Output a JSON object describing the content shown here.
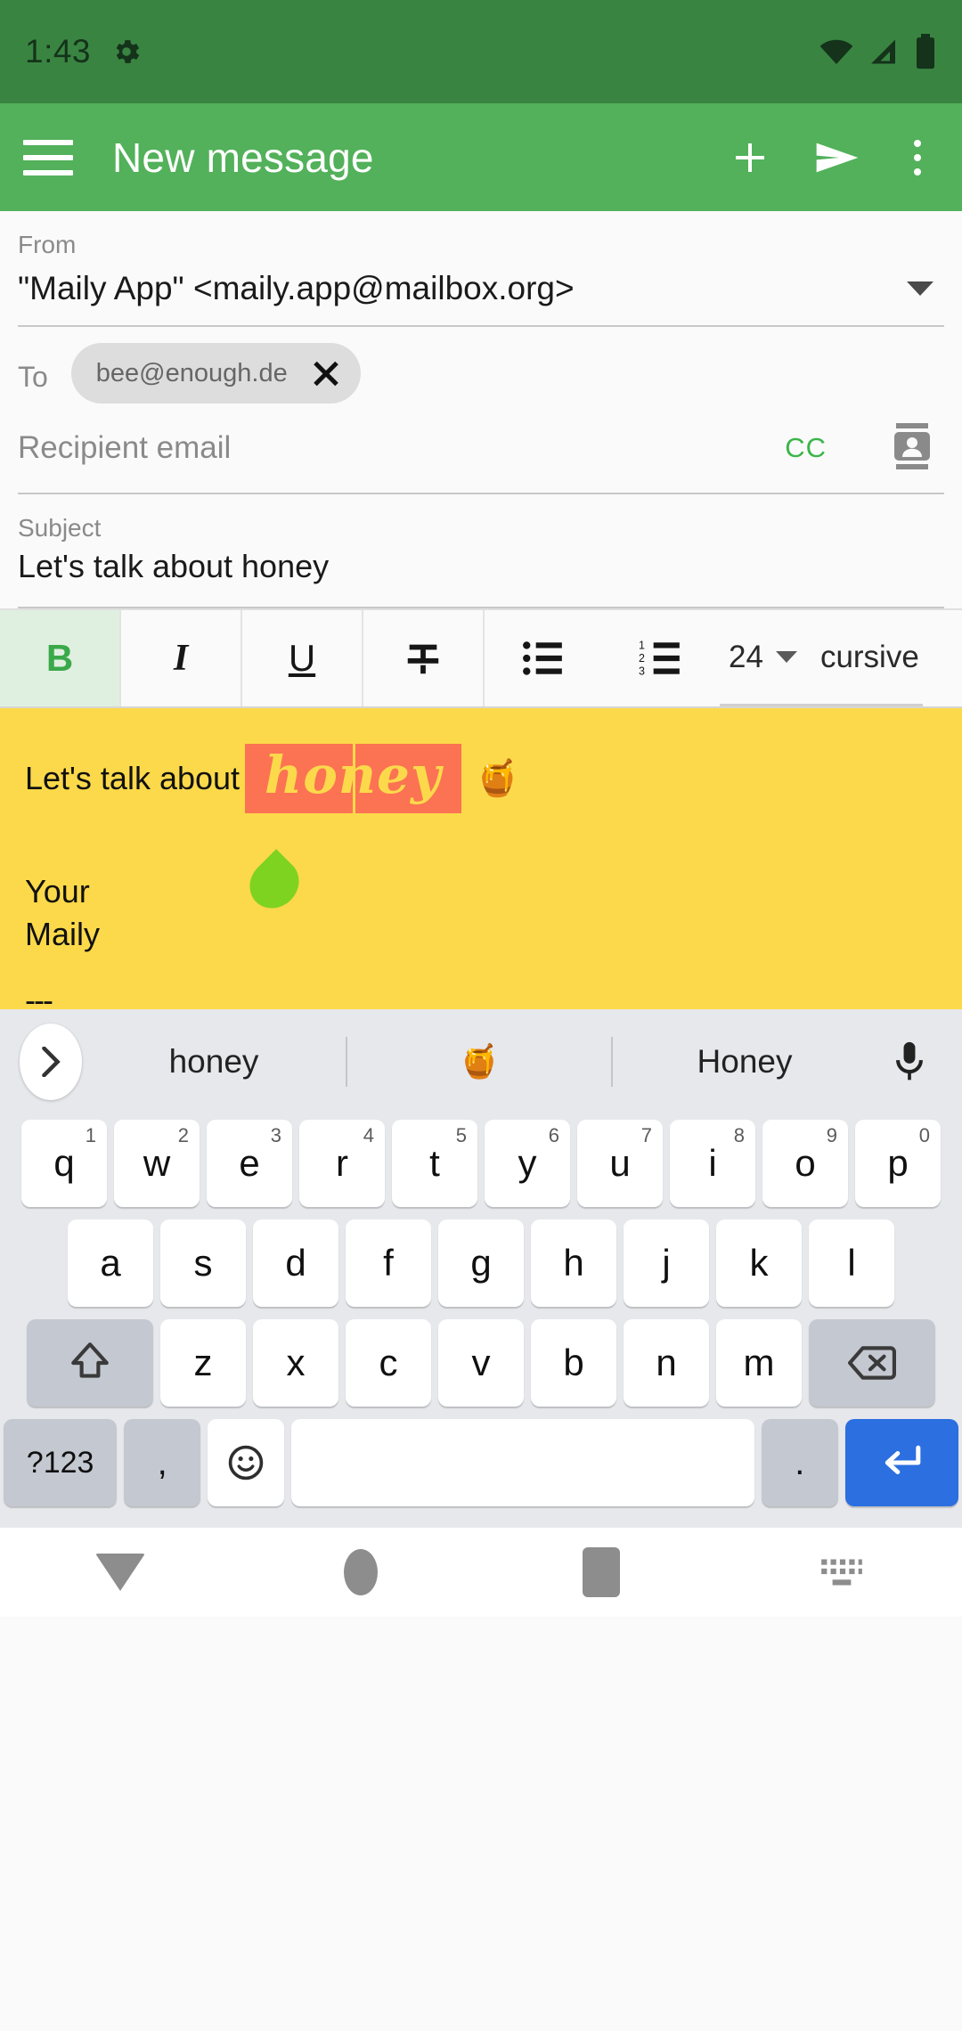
{
  "status_bar": {
    "time": "1:43",
    "gear_icon": "gear-icon",
    "wifi_icon": "wifi-icon",
    "signal_icon": "cellular-signal-icon",
    "battery_icon": "battery-icon",
    "background_color": "#3a8442"
  },
  "app_bar": {
    "menu_icon": "hamburger-menu-icon",
    "title": "New message",
    "attach_icon": "plus-icon",
    "send_icon": "send-icon",
    "overflow_icon": "more-vertical-icon",
    "background_color": "#52b15a"
  },
  "compose": {
    "from_label": "From",
    "from_value": "\"Maily App\" <maily.app@mailbox.org>",
    "from_dropdown_icon": "chevron-down-icon",
    "to_label": "To",
    "recipient_chip": {
      "text": "bee@enough.de",
      "remove_icon": "close-icon"
    },
    "recipient_placeholder": "Recipient email",
    "cc_label": "CC",
    "cc_color": "#3bb54a",
    "contacts_icon": "contact-card-icon",
    "subject_label": "Subject",
    "subject_value": "Let's talk about honey"
  },
  "format_toolbar": {
    "bold": {
      "label": "B",
      "active": true,
      "active_color": "#3aa94a",
      "active_bg": "#dff0e0"
    },
    "italic": {
      "label": "I",
      "active": false
    },
    "underline": {
      "label": "U",
      "active": false
    },
    "strikethrough": {
      "label": "S",
      "active": false,
      "icon": "strikethrough-icon"
    },
    "bullet_list_icon": "bullet-list-icon",
    "numbered_list_icon": "numbered-list-icon",
    "font_size": "24",
    "font_size_caret_icon": "chevron-down-icon",
    "font_family": "cursive"
  },
  "message_body": {
    "background_color": "#fcd94a",
    "line1_prefix": "Let's talk about",
    "selected_word": "honey",
    "selection_bg": "#fb7353",
    "selection_text_color": "#fcd94a",
    "emoji": "🍯",
    "selection_handle_color": "#7ed321",
    "signature_line1": "Your",
    "signature_line2": "Maily",
    "signature_separator": "---"
  },
  "keyboard": {
    "suggestions": {
      "expand_icon": "chevron-right-icon",
      "items": [
        "honey",
        "🍯",
        "Honey"
      ],
      "mic_icon": "microphone-icon"
    },
    "row1": [
      {
        "key": "q",
        "num": "1"
      },
      {
        "key": "w",
        "num": "2"
      },
      {
        "key": "e",
        "num": "3"
      },
      {
        "key": "r",
        "num": "4"
      },
      {
        "key": "t",
        "num": "5"
      },
      {
        "key": "y",
        "num": "6"
      },
      {
        "key": "u",
        "num": "7"
      },
      {
        "key": "i",
        "num": "8"
      },
      {
        "key": "o",
        "num": "9"
      },
      {
        "key": "p",
        "num": "0"
      }
    ],
    "row2": [
      "a",
      "s",
      "d",
      "f",
      "g",
      "h",
      "j",
      "k",
      "l"
    ],
    "row3": {
      "shift_icon": "shift-icon",
      "keys": [
        "z",
        "x",
        "c",
        "v",
        "b",
        "n",
        "m"
      ],
      "backspace_icon": "backspace-icon"
    },
    "row4": {
      "symbols_label": "?123",
      "comma": ",",
      "emoji_icon": "emoji-smiley-icon",
      "space": "",
      "period": ".",
      "enter_icon": "enter-icon",
      "enter_bg": "#2b6fe0"
    }
  },
  "nav_bar": {
    "back_icon": "hide-keyboard-icon",
    "home_icon": "home-icon",
    "recents_icon": "recents-icon",
    "keyboard_switch_icon": "keyboard-switcher-icon"
  }
}
